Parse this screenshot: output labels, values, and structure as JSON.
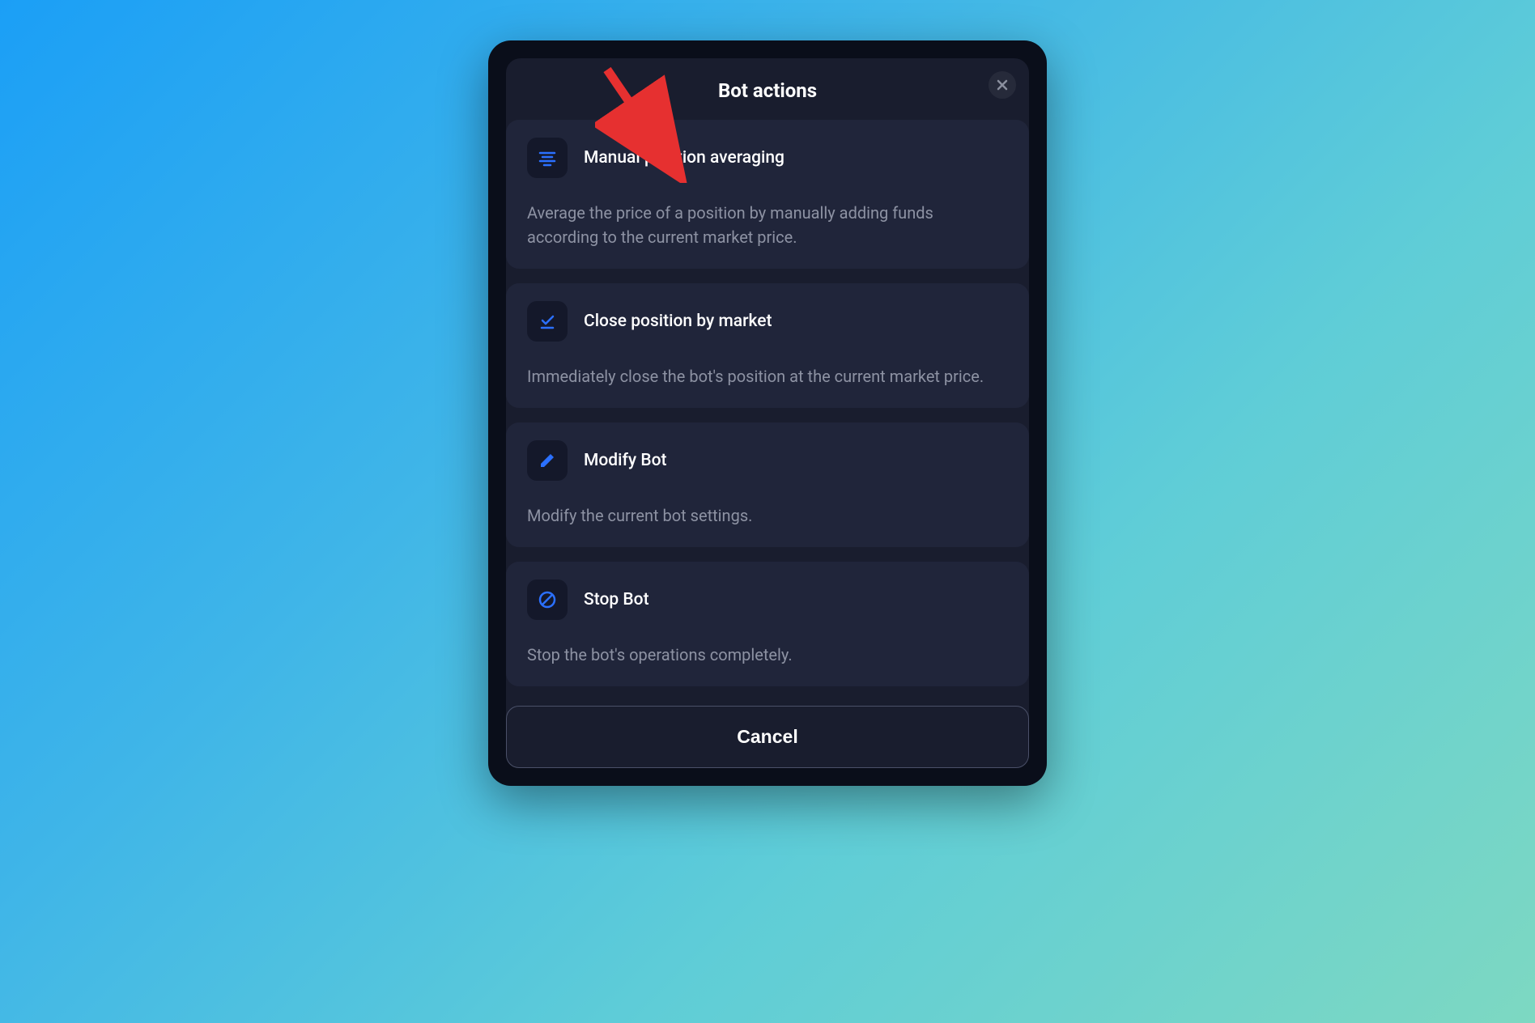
{
  "modal": {
    "title": "Bot actions",
    "cancel_label": "Cancel"
  },
  "actions": [
    {
      "title": "Manual position averaging",
      "description": "Average the price of a position by manually adding funds according to the current market price.",
      "icon": "lines-center-icon"
    },
    {
      "title": "Close position by market",
      "description": "Immediately close the bot's position at the current market price.",
      "icon": "check-underline-icon"
    },
    {
      "title": "Modify Bot",
      "description": "Modify the current bot settings.",
      "icon": "pencil-icon"
    },
    {
      "title": "Stop Bot",
      "description": "Stop the bot's operations completely.",
      "icon": "prohibit-icon"
    }
  ]
}
